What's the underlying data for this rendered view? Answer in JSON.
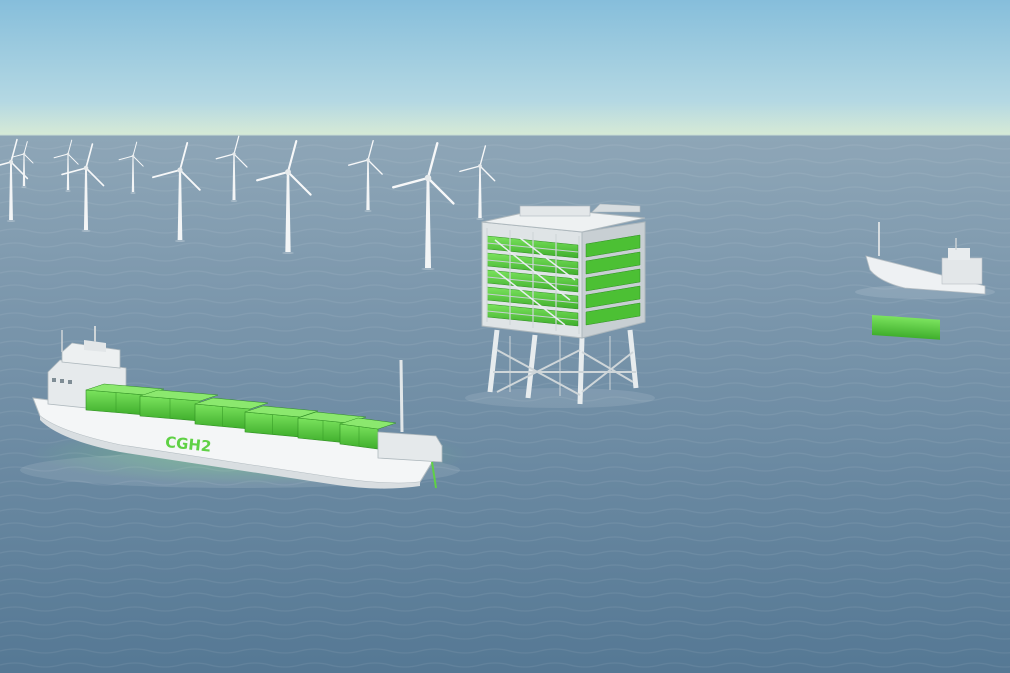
{
  "scene": {
    "kind": "offshore hydrogen production render",
    "colors": {
      "sky_top": "#8fc3dd",
      "sky_horizon": "#cfe6d8",
      "sea_far": "#8aa3b6",
      "sea_near": "#5e7f9c",
      "hull": "#f2f4f5",
      "accent_green": "#5fd145",
      "accent_green_dark": "#3fae2c",
      "structure_grey": "#d7dcde"
    }
  },
  "ship_large": {
    "hull_text": "CGH2"
  },
  "ship_small": {},
  "platform": {},
  "turbines": {}
}
